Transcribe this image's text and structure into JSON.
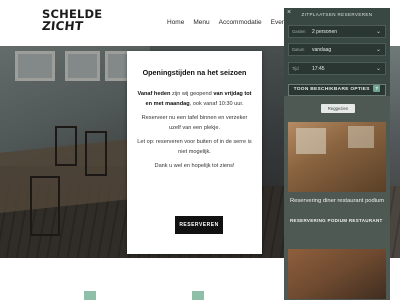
{
  "brand": {
    "line1": "SCHELDE",
    "line2": "ZICHT"
  },
  "nav": [
    {
      "label": "Home"
    },
    {
      "label": "Menu"
    },
    {
      "label": "Accommodatie"
    },
    {
      "label": "Even"
    }
  ],
  "modal": {
    "title": "Openingstijden na het seizoen",
    "p1_strong_a": "Vanaf heden",
    "p1_mid": " zijn wij geopend ",
    "p1_strong_b": "van vrijdag tot en met maandag",
    "p1_end": ", ook vanaf 10:30 uur.",
    "p2": "Reserveer nu een tafel binnen en verzeker uzelf van een plekje.",
    "p3": "Let op: reserveren voor buiten of in de serre is niet mogelijk.",
    "p4": "Dank u wel en hopelijk tot ziens!",
    "button": "RESERVEREN"
  },
  "widget": {
    "title": "ZITPLAATSEN RESERVEREN",
    "close": "×",
    "fields": [
      {
        "label": "Gasten",
        "value": "2 personen"
      },
      {
        "label": "Datum",
        "value": "vandaag"
      },
      {
        "label": "Tijd",
        "value": "17:45"
      }
    ],
    "button": "TOON BESCHIKBARE OPTIES",
    "help": "?"
  },
  "side": {
    "pill": "Reggezien",
    "card_title": "Reservering diner restaurant podium",
    "card_sub": "RESERVERING PODIUM RESTAURANT"
  }
}
